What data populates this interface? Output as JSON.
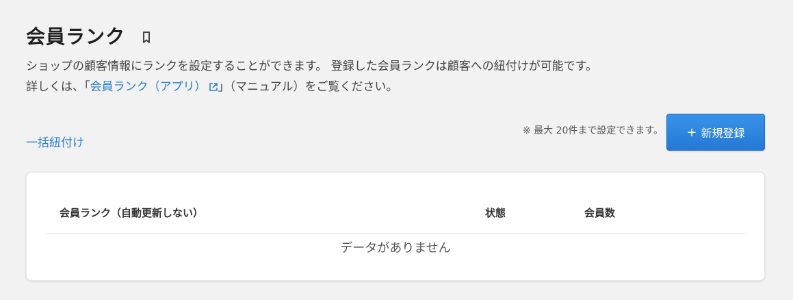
{
  "header": {
    "title": "会員ランク",
    "bookmark_icon": "bookmark-icon"
  },
  "description": {
    "line1": "ショップの顧客情報にランクを設定することができます。 登録した会員ランクは顧客への紐付けが可能です。",
    "line2_prefix": "詳しくは、「",
    "link_text": "会員ランク（アプリ）",
    "link_icon": "external-link-icon",
    "line2_suffix": "」（マニュアル）をご覧ください。"
  },
  "actions": {
    "bulk_link": "一括紐付け",
    "limit_note": "※ 最大 20件まで設定できます。",
    "new_button_plus": "+",
    "new_button_label": "新規登録"
  },
  "table": {
    "columns": {
      "rank": "会員ランク（自動更新しない）",
      "status": "状態",
      "count": "会員数"
    },
    "empty_message": "データがありません"
  },
  "colors": {
    "accent": "#2a7fd6",
    "button": "#2379d4",
    "background": "#f2f2f2"
  }
}
